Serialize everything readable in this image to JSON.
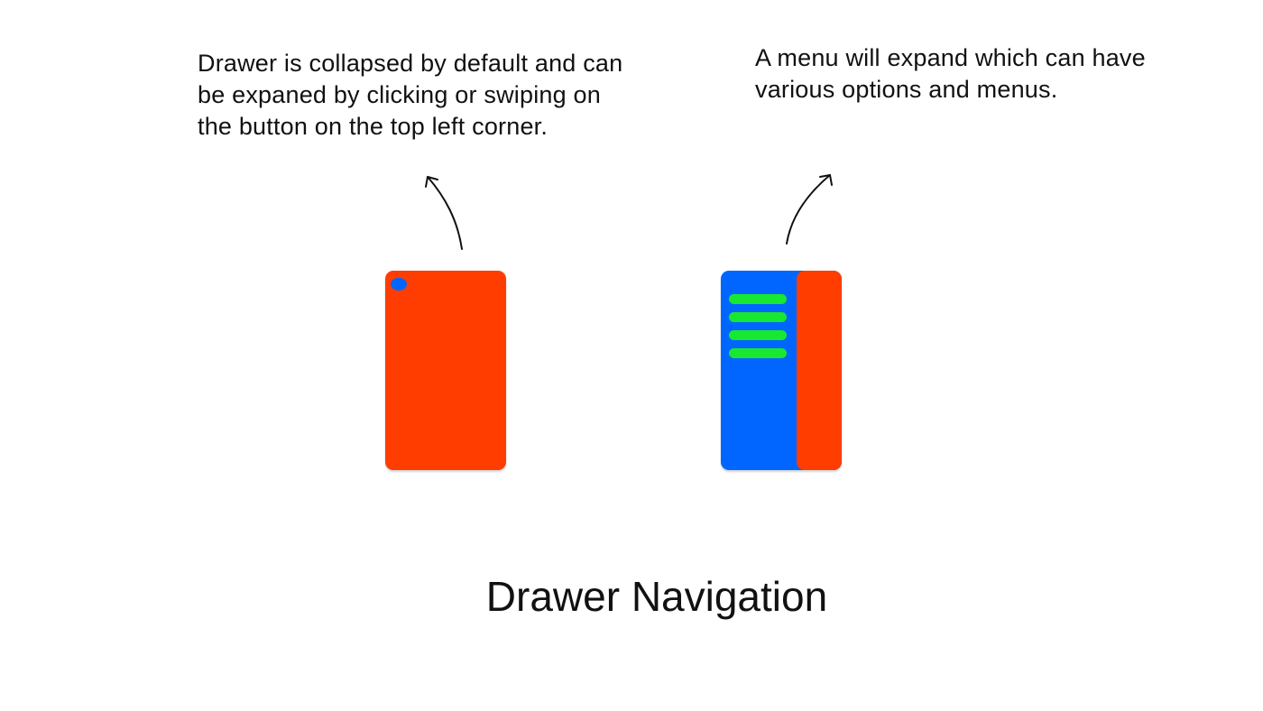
{
  "colors": {
    "screen": "#ff3d00",
    "drawer": "#0066ff",
    "menu_item": "#18e830",
    "text": "#111111"
  },
  "notes": {
    "collapsed": {
      "lines": [
        "Drawer is collapsed by default and can",
        "be expaned by clicking or swiping on",
        "the button on the top left corner."
      ]
    },
    "expanded": {
      "lines": [
        "A menu will expand which can have",
        "various options and menus."
      ]
    }
  },
  "drawer_menu": {
    "item_count": 4
  },
  "title": "Drawer Navigation"
}
